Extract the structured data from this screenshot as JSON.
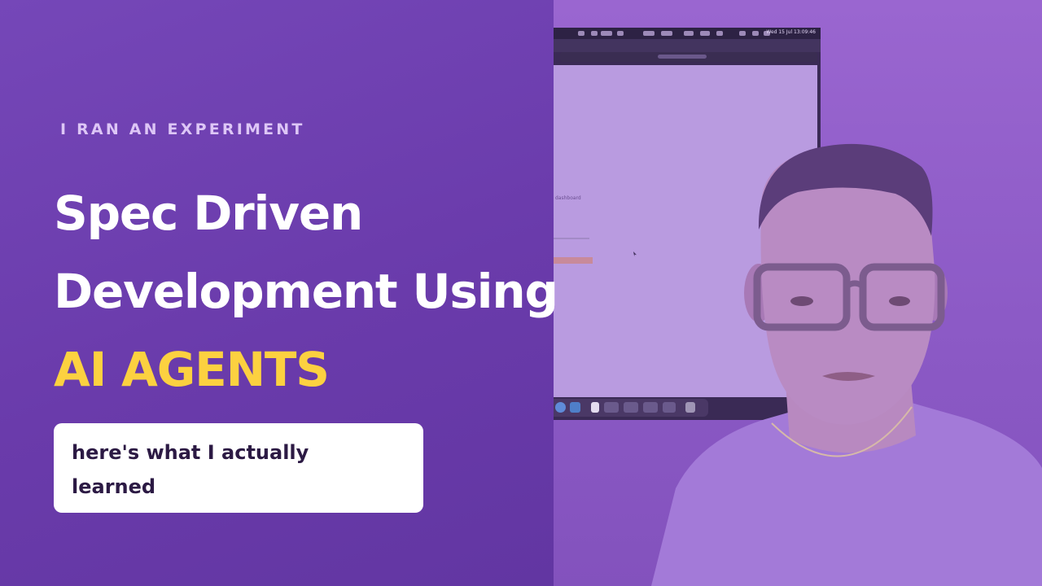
{
  "thumbnail": {
    "eyebrow": "I RAN AN EXPERIMENT",
    "headline_line1": "Spec Driven",
    "headline_line2": "Development Using",
    "headline_accent": "AI AGENTS",
    "subtitle": "here's what I actually learned"
  },
  "background_screen": {
    "clock": "Wed 15 Jul  13:09:46",
    "page_text": "dashboard"
  },
  "colors": {
    "left_panel": "#6e3fb0",
    "right_panel": "#9a66d0",
    "headline_text": "#ffffff",
    "accent_text": "#fcd140",
    "eyebrow_text": "#ddc6f6",
    "card_background": "#ffffff",
    "card_text": "#2c1a44"
  }
}
